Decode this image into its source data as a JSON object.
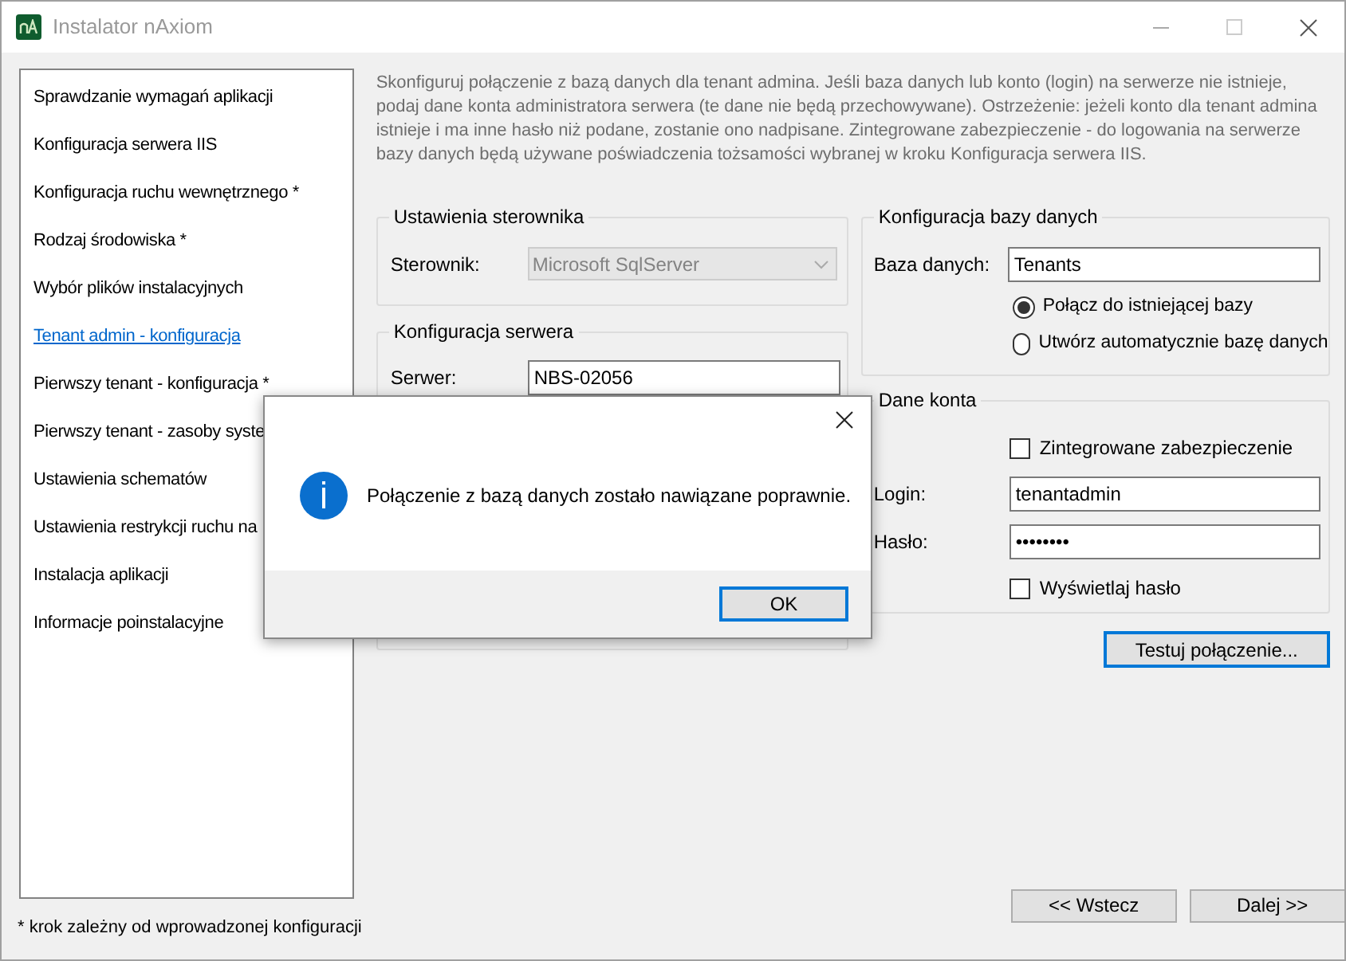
{
  "window": {
    "title": "Instalator nAxiom"
  },
  "sidebar": {
    "items": [
      {
        "label": "Sprawdzanie wymagań aplikacji",
        "selected": false
      },
      {
        "label": "Konfiguracja serwera IIS",
        "selected": false
      },
      {
        "label": "Konfiguracja ruchu wewnętrznego *",
        "selected": false
      },
      {
        "label": "Rodzaj środowiska *",
        "selected": false
      },
      {
        "label": "Wybór plików instalacyjnych",
        "selected": false
      },
      {
        "label": "Tenant admin - konfiguracja",
        "selected": true
      },
      {
        "label": "Pierwszy tenant - konfiguracja *",
        "selected": false
      },
      {
        "label": "Pierwszy tenant - zasoby syste",
        "selected": false
      },
      {
        "label": "Ustawienia schematów",
        "selected": false
      },
      {
        "label": "Ustawienia restrykcji ruchu na",
        "selected": false
      },
      {
        "label": "Instalacja aplikacji",
        "selected": false
      },
      {
        "label": "Informacje poinstalacyjne",
        "selected": false
      }
    ]
  },
  "description": "Skonfiguruj połączenie z bazą danych dla tenant admina. Jeśli baza danych lub konto (login) na serwerze nie istnieje, podaj dane konta administratora serwera (te dane nie będą przechowywane). Ostrzeżenie: jeżeli konto dla tenant admina istnieje i ma inne hasło niż podane, zostanie ono nadpisane.  Zintegrowane zabezpieczenie - do logowania na serwerze bazy danych będą używane poświadczenia tożsamości wybranej w kroku Konfiguracja serwera IIS.",
  "driver_settings": {
    "title": "Ustawienia sterownika",
    "label": "Sterownik:",
    "value": "Microsoft SqlServer",
    "disabled": true
  },
  "server_config": {
    "title": "Konfiguracja serwera",
    "server_label": "Serwer:",
    "server_value": "NBS-02056"
  },
  "database_config": {
    "title": "Konfiguracja bazy danych",
    "label": "Baza danych:",
    "value": "Tenants",
    "options": [
      {
        "label": "Połącz do istniejącej bazy",
        "selected": true
      },
      {
        "label": "Utwórz automatycznie bazę danych",
        "selected": false
      }
    ]
  },
  "account": {
    "title": "Dane konta",
    "integrated": {
      "label": "Zintegrowane zabezpieczenie",
      "checked": false
    },
    "login_label": "Login:",
    "login_value": "tenantadmin",
    "password_label": "Hasło:",
    "password_value": "••••••••",
    "show_password": {
      "label": "Wyświetlaj hasło",
      "checked": false
    }
  },
  "test_button": "Testuj połączenie...",
  "footnote": "* krok zależny od wprowadzonej konfiguracji",
  "nav_buttons": [
    "<< Wstecz",
    "Dalej >>"
  ],
  "dialog": {
    "message": "Połączenie z bazą danych zostało nawiązane poprawnie.",
    "button": "OK"
  }
}
